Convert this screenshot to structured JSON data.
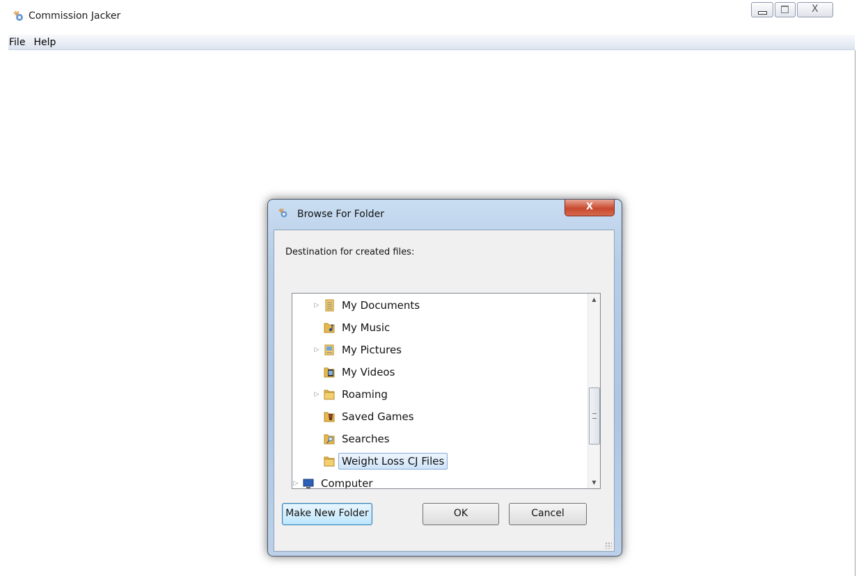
{
  "window": {
    "title": "Commission Jacker",
    "close_glyph": "X"
  },
  "menu": [
    "File",
    "Help"
  ],
  "dialog": {
    "title": "Browse For Folder",
    "close_glyph": "X",
    "prompt": "Destination for created files:",
    "tree": [
      {
        "label": "My Documents",
        "icon": "documents-folder-icon",
        "expandable": true,
        "level": 1,
        "selected": false
      },
      {
        "label": "My Music",
        "icon": "music-folder-icon",
        "expandable": false,
        "level": 1,
        "selected": false
      },
      {
        "label": "My Pictures",
        "icon": "pictures-folder-icon",
        "expandable": true,
        "level": 1,
        "selected": false
      },
      {
        "label": "My Videos",
        "icon": "videos-folder-icon",
        "expandable": false,
        "level": 1,
        "selected": false
      },
      {
        "label": "Roaming",
        "icon": "folder-icon",
        "expandable": true,
        "level": 1,
        "selected": false
      },
      {
        "label": "Saved Games",
        "icon": "saved-games-folder-icon",
        "expandable": false,
        "level": 1,
        "selected": false
      },
      {
        "label": "Searches",
        "icon": "searches-folder-icon",
        "expandable": false,
        "level": 1,
        "selected": false
      },
      {
        "label": "Weight Loss CJ Files",
        "icon": "folder-icon",
        "expandable": false,
        "level": 1,
        "selected": true
      },
      {
        "label": "Computer",
        "icon": "computer-icon",
        "expandable": true,
        "level": 0,
        "selected": false
      }
    ],
    "buttons": {
      "make_new_folder": "Make New Folder",
      "ok": "OK",
      "cancel": "Cancel"
    }
  },
  "colors": {
    "folder": "#e8b84a",
    "selection_border": "#84acdd",
    "dialog_frame": "#b6cde6",
    "close_red": "#c8492f"
  }
}
